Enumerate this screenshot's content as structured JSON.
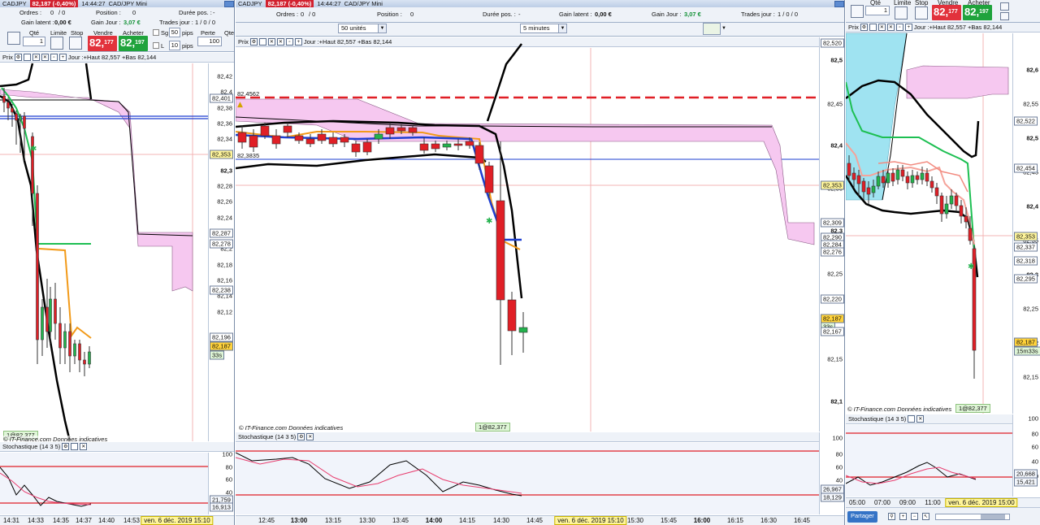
{
  "left": {
    "title": "CADJPY",
    "price_chip": "82,187 (-0,40%)",
    "time": "14:44:27",
    "subtitle": "CAD/JPY Mini",
    "info": {
      "ordres_label": "Ordres :",
      "ordres_value": "0",
      "ordres_sub": "/ 0",
      "position_label": "Position :",
      "position_value": "0",
      "duree_label": "Durée pos. :",
      "duree_value": "-",
      "gain_latent_label": "Gain latent :",
      "gain_latent_value": "0,00 €",
      "gain_jour_label": "Gain Jour :",
      "gain_jour_value": "3,07 €",
      "trades_label": "Trades jour :",
      "trades_value": "1 / 0 / 0"
    },
    "order": {
      "qte_label": "Qté",
      "qte_value": "1",
      "limite_label": "Limite",
      "stop_label": "Stop",
      "vendre_label": "Vendre",
      "acheter_label": "Acheter",
      "sell_price": "82,",
      "sell_sup": "177",
      "buy_price": "82,",
      "buy_sup": "197",
      "sg_label": "Sg",
      "sg_value": "50",
      "pips_label": "pips",
      "l_label": "L",
      "l_value": "10",
      "perte_label": "Perte",
      "perte_value": "100",
      "qte2_label": "Qte"
    },
    "toolbar_label": "Prix",
    "toolbar_text": "Jour :+Haut 82,557 +Bas 82,144",
    "yticks": [
      "82,42",
      "82,4",
      "82,38",
      "82,36",
      "82,34",
      "82,32",
      "82,3",
      "82,28",
      "82,26",
      "82,24",
      "82,22",
      "82,2",
      "82,18",
      "82,16",
      "82,14",
      "82,12"
    ],
    "badges": [
      "82,401",
      "82,353",
      "82,287",
      "82,278",
      "82,238",
      "82,196",
      "82,187",
      "33s"
    ],
    "position_badge": "1@82,377",
    "footnote": "© IT-Finance.com  Données indicatives",
    "stoch_title": "Stochastique (14 3 5)",
    "stoch_ticks": [
      "100",
      "80",
      "60",
      "40",
      "20"
    ],
    "stoch_badges": [
      "21,759",
      "16,913"
    ],
    "xticks": [
      "14:31",
      "14:33",
      "14:35",
      "14:37",
      "14:40",
      "14:53"
    ],
    "x_highlight": "ven. 6 déc. 2019 15:10"
  },
  "middle": {
    "title": "CADJPY",
    "price_chip": "82,187 (-0,40%)",
    "time": "14:44:27",
    "subtitle": "CAD/JPY Mini",
    "info": {
      "ordres_label": "Ordres :",
      "ordres_value": "0",
      "ordres_sub": "/ 0",
      "position_label": "Position :",
      "position_value": "0",
      "duree_label": "Durée pos. :",
      "duree_value": "-",
      "gain_latent_label": "Gain latent :",
      "gain_latent_value": "0,00 €",
      "gain_jour_label": "Gain Jour :",
      "gain_jour_value": "3,07 €",
      "trades_label": "Trades jour :",
      "trades_value": "1 / 0 / 0"
    },
    "units_select": "50 unités",
    "period_select": "5 minutes",
    "toolbar_label": "Prix",
    "toolbar_text": "Jour :+Haut 82,557 +Bas 82,144",
    "label_top": "82,4562",
    "label_low": "82,3835",
    "yticks": [
      "82,5",
      "82,45",
      "82,4",
      "82,35",
      "82,3",
      "82,25",
      "82,2",
      "82,15",
      "82,1"
    ],
    "badges": [
      "82,520",
      "82,353",
      "82,309",
      "82,290",
      "82,284",
      "82,276",
      "82,220",
      "82,187",
      "33s",
      "82,167"
    ],
    "position_badge": "1@82,377",
    "footnote": "© IT-Finance.com  Données indicatives",
    "stoch_title": "Stochastique (14 3 5)",
    "stoch_ticks": [
      "100",
      "80",
      "60",
      "40",
      "20"
    ],
    "stoch_badges": [
      "26,967",
      "18,129"
    ],
    "xticks": [
      "12:45",
      "13:00",
      "13:15",
      "13:30",
      "13:45",
      "14:00",
      "14:15",
      "14:30",
      "14:45",
      "15:30",
      "15:45",
      "16:00",
      "16:15",
      "16:30",
      "16:45"
    ],
    "x_highlight": "ven. 6 déc. 2019 15:10"
  },
  "right": {
    "qte_label": "Qté",
    "qte_value": "1",
    "limite_label": "Limite",
    "stop_label": "Stop",
    "vendre_label": "Vendre",
    "acheter_label": "Acheter",
    "sell_price": "82,",
    "sell_sup": "177",
    "buy_price": "82,",
    "buy_sup": "197",
    "toolbar_label": "Prix",
    "toolbar_text": "Jour :+Haut 82,557 +Bas 82,144",
    "yticks": [
      "82,6",
      "82,55",
      "82,5",
      "82,45",
      "82,4",
      "82,35",
      "82,3",
      "82,25",
      "82,2",
      "82,15"
    ],
    "badges": [
      "82,522",
      "82,454",
      "82,353",
      "82,337",
      "82,318",
      "82,295",
      "82,187",
      "15m33s"
    ],
    "position_badge": "1@82,377",
    "footnote": "© IT-Finance.com  Données indicatives",
    "stoch_title": "Stochastique (14 3 5)",
    "stoch_ticks": [
      "100",
      "80",
      "60",
      "40",
      "20"
    ],
    "stoch_badges": [
      "20,668",
      "15,421"
    ],
    "xticks": [
      "05:00",
      "07:00",
      "09:00",
      "11:00"
    ],
    "x_highlight": "ven. 6 déc. 2019 15:00",
    "partager_label": "Partager"
  },
  "colors": {
    "bull": "#22b24c",
    "bear": "#e01f26",
    "cloud": "#f6c8f0",
    "cloud_cyan": "#9fe3f1",
    "ma_black": "#000000",
    "ma_orange": "#f29a19",
    "ma_blue": "#1e3fd1",
    "ma_green": "#1dbf52",
    "ma_salmon": "#f5a39a",
    "stoch_fast": "#000000",
    "stoch_slow": "#e83d6e",
    "level_red": "#e01f26"
  }
}
